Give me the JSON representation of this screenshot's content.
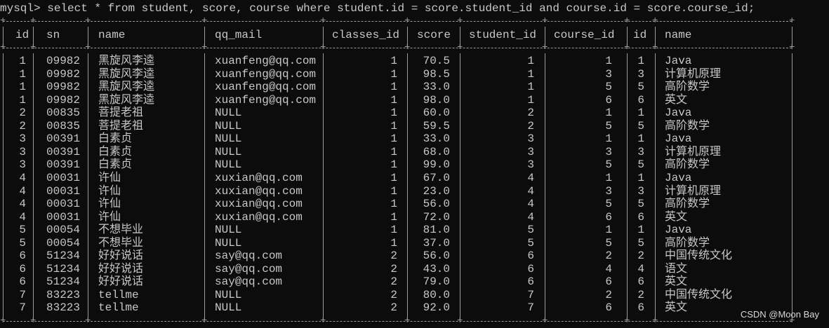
{
  "terminal": {
    "prompt": "mysql>",
    "command": "select * from student, score, course where student.id = score.student_id and course.id = score.course_id;"
  },
  "table": {
    "columns": [
      "id",
      "sn",
      "name",
      "qq_mail",
      "classes_id",
      "score",
      "student_id",
      "course_id",
      "id",
      "name"
    ],
    "rows": [
      [
        "1",
        "09982",
        "黑旋风李逵",
        "xuanfeng@qq.com",
        "1",
        "70.5",
        "1",
        "1",
        "1",
        "Java"
      ],
      [
        "1",
        "09982",
        "黑旋风李逵",
        "xuanfeng@qq.com",
        "1",
        "98.5",
        "1",
        "3",
        "3",
        "计算机原理"
      ],
      [
        "1",
        "09982",
        "黑旋风李逵",
        "xuanfeng@qq.com",
        "1",
        "33.0",
        "1",
        "5",
        "5",
        "高阶数学"
      ],
      [
        "1",
        "09982",
        "黑旋风李逵",
        "xuanfeng@qq.com",
        "1",
        "98.0",
        "1",
        "6",
        "6",
        "英文"
      ],
      [
        "2",
        "00835",
        "菩提老祖",
        "NULL",
        "1",
        "60.0",
        "2",
        "1",
        "1",
        "Java"
      ],
      [
        "2",
        "00835",
        "菩提老祖",
        "NULL",
        "1",
        "59.5",
        "2",
        "5",
        "5",
        "高阶数学"
      ],
      [
        "3",
        "00391",
        "白素贞",
        "NULL",
        "1",
        "33.0",
        "3",
        "1",
        "1",
        "Java"
      ],
      [
        "3",
        "00391",
        "白素贞",
        "NULL",
        "1",
        "68.0",
        "3",
        "3",
        "3",
        "计算机原理"
      ],
      [
        "3",
        "00391",
        "白素贞",
        "NULL",
        "1",
        "99.0",
        "3",
        "5",
        "5",
        "高阶数学"
      ],
      [
        "4",
        "00031",
        "许仙",
        "xuxian@qq.com",
        "1",
        "67.0",
        "4",
        "1",
        "1",
        "Java"
      ],
      [
        "4",
        "00031",
        "许仙",
        "xuxian@qq.com",
        "1",
        "23.0",
        "4",
        "3",
        "3",
        "计算机原理"
      ],
      [
        "4",
        "00031",
        "许仙",
        "xuxian@qq.com",
        "1",
        "56.0",
        "4",
        "5",
        "5",
        "高阶数学"
      ],
      [
        "4",
        "00031",
        "许仙",
        "xuxian@qq.com",
        "1",
        "72.0",
        "4",
        "6",
        "6",
        "英文"
      ],
      [
        "5",
        "00054",
        "不想毕业",
        "NULL",
        "1",
        "81.0",
        "5",
        "1",
        "1",
        "Java"
      ],
      [
        "5",
        "00054",
        "不想毕业",
        "NULL",
        "1",
        "37.0",
        "5",
        "5",
        "5",
        "高阶数学"
      ],
      [
        "6",
        "51234",
        "好好说话",
        "say@qq.com",
        "2",
        "56.0",
        "6",
        "2",
        "2",
        "中国传统文化"
      ],
      [
        "6",
        "51234",
        "好好说话",
        "say@qq.com",
        "2",
        "43.0",
        "6",
        "4",
        "4",
        "语文"
      ],
      [
        "6",
        "51234",
        "好好说话",
        "say@qq.com",
        "2",
        "79.0",
        "6",
        "6",
        "6",
        "英文"
      ],
      [
        "7",
        "83223",
        "tellme",
        "NULL",
        "2",
        "80.0",
        "7",
        "2",
        "2",
        "中国传统文化"
      ],
      [
        "7",
        "83223",
        "tellme",
        "NULL",
        "2",
        "92.0",
        "7",
        "6",
        "6",
        "英文"
      ]
    ]
  },
  "watermark": "CSDN @Moon Bay",
  "colors": {
    "background": "#0c0c0c",
    "text": "#c8c8c8",
    "border": "#9a9a9a"
  }
}
